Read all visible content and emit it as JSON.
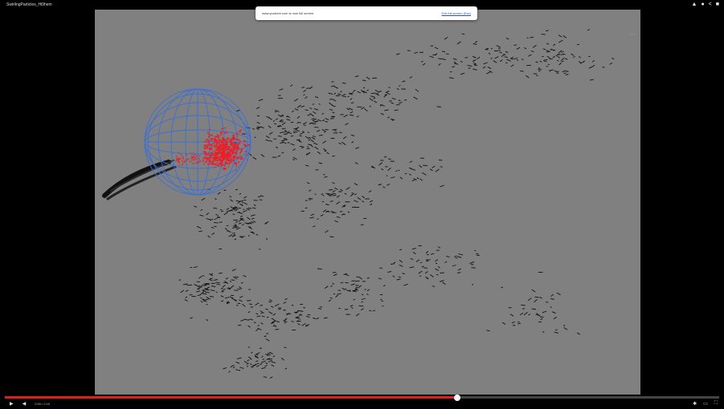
{
  "video": {
    "title": "SwirlingParticles_Hi9hem"
  },
  "fullscreen_notice": {
    "message": "www.youtube.com is now full screen.",
    "exit_label": "Exit full screen (Esc)"
  },
  "overlay": {
    "more_label": "•••"
  },
  "player": {
    "progress": 0.633,
    "time": "0:00 / 0:10",
    "colors": {
      "played": "#e01e1e",
      "background": "#808080",
      "sphere": "#3a6fd8",
      "particles_hot": "#e8202a",
      "particles": "#111111"
    }
  },
  "icons": {
    "play": "play-icon",
    "next": "next-icon",
    "volume": "volume-icon",
    "settings": "gear-icon",
    "theater": "theater-icon",
    "fullscreen": "fullscreen-icon",
    "like": "like-icon",
    "info": "info-icon",
    "share": "share-icon"
  }
}
